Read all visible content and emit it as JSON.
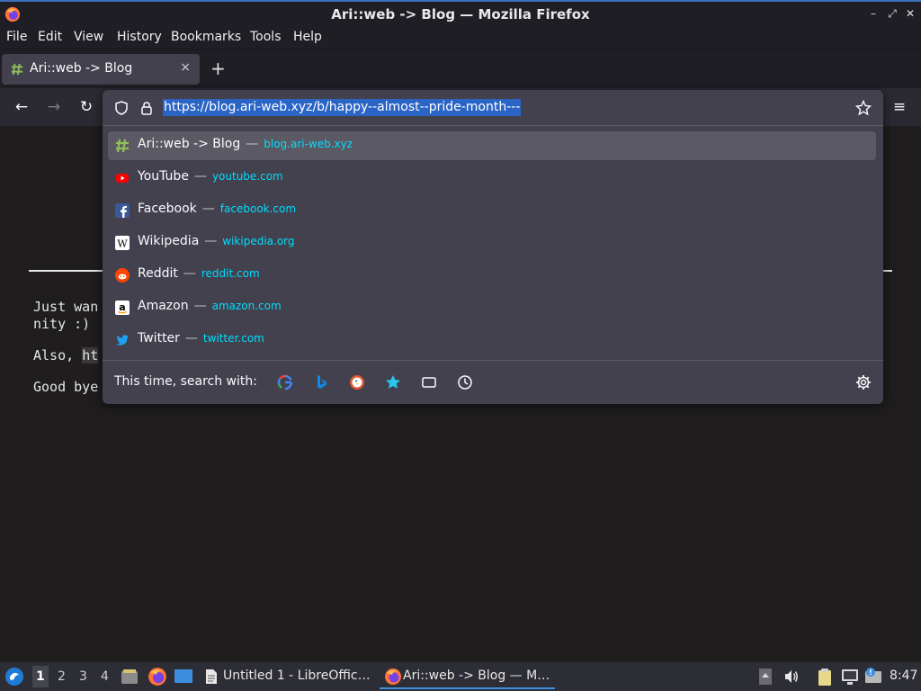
{
  "window": {
    "title": "Ari::web -> Blog — Mozilla Firefox"
  },
  "menubar": [
    "File",
    "Edit",
    "View",
    "History",
    "Bookmarks",
    "Tools",
    "Help"
  ],
  "tab": {
    "title": "Ari::web -> Blog",
    "close": "×",
    "new_tab": "+"
  },
  "navbar": {
    "url": "https://blog.ari-web.xyz/b/happy--almost--pride-month---"
  },
  "page": {
    "line1": "Just wan",
    "line2": "nity :)",
    "line3a": "Also, ",
    "line3b": "ht",
    "line4": "Good bye"
  },
  "suggestions": [
    {
      "title": "Ari::web -> Blog",
      "url": "blog.ari-web.xyz",
      "icon": "hash-favicon",
      "selected": true
    },
    {
      "title": "YouTube",
      "url": "youtube.com",
      "icon": "youtube-icon",
      "selected": false
    },
    {
      "title": "Facebook",
      "url": "facebook.com",
      "icon": "facebook-icon",
      "selected": false
    },
    {
      "title": "Wikipedia",
      "url": "wikipedia.org",
      "icon": "wikipedia-icon",
      "selected": false
    },
    {
      "title": "Reddit",
      "url": "reddit.com",
      "icon": "reddit-icon",
      "selected": false
    },
    {
      "title": "Amazon",
      "url": "amazon.com",
      "icon": "amazon-icon",
      "selected": false
    },
    {
      "title": "Twitter",
      "url": "twitter.com",
      "icon": "twitter-icon",
      "selected": false
    }
  ],
  "separator": "—",
  "search_with": {
    "label": "This time, search with:",
    "engines": [
      "google-icon",
      "bing-icon",
      "duckduckgo-icon",
      "bookmarks-icon",
      "tabs-icon",
      "history-icon"
    ]
  },
  "taskbar": {
    "workspaces": [
      "1",
      "2",
      "3",
      "4"
    ],
    "tasks": [
      {
        "label": "Untitled 1 - LibreOffic…",
        "icon": "document-icon",
        "active": false
      },
      {
        "label": "Ari::web -> Blog — M…",
        "icon": "firefox-icon",
        "active": true
      }
    ],
    "clock": "8:47"
  },
  "colors": {
    "accent": "#2a64c5",
    "url_link": "#00ddff",
    "panel": "#42414d",
    "taskbar_active": "#3d8ee0"
  }
}
